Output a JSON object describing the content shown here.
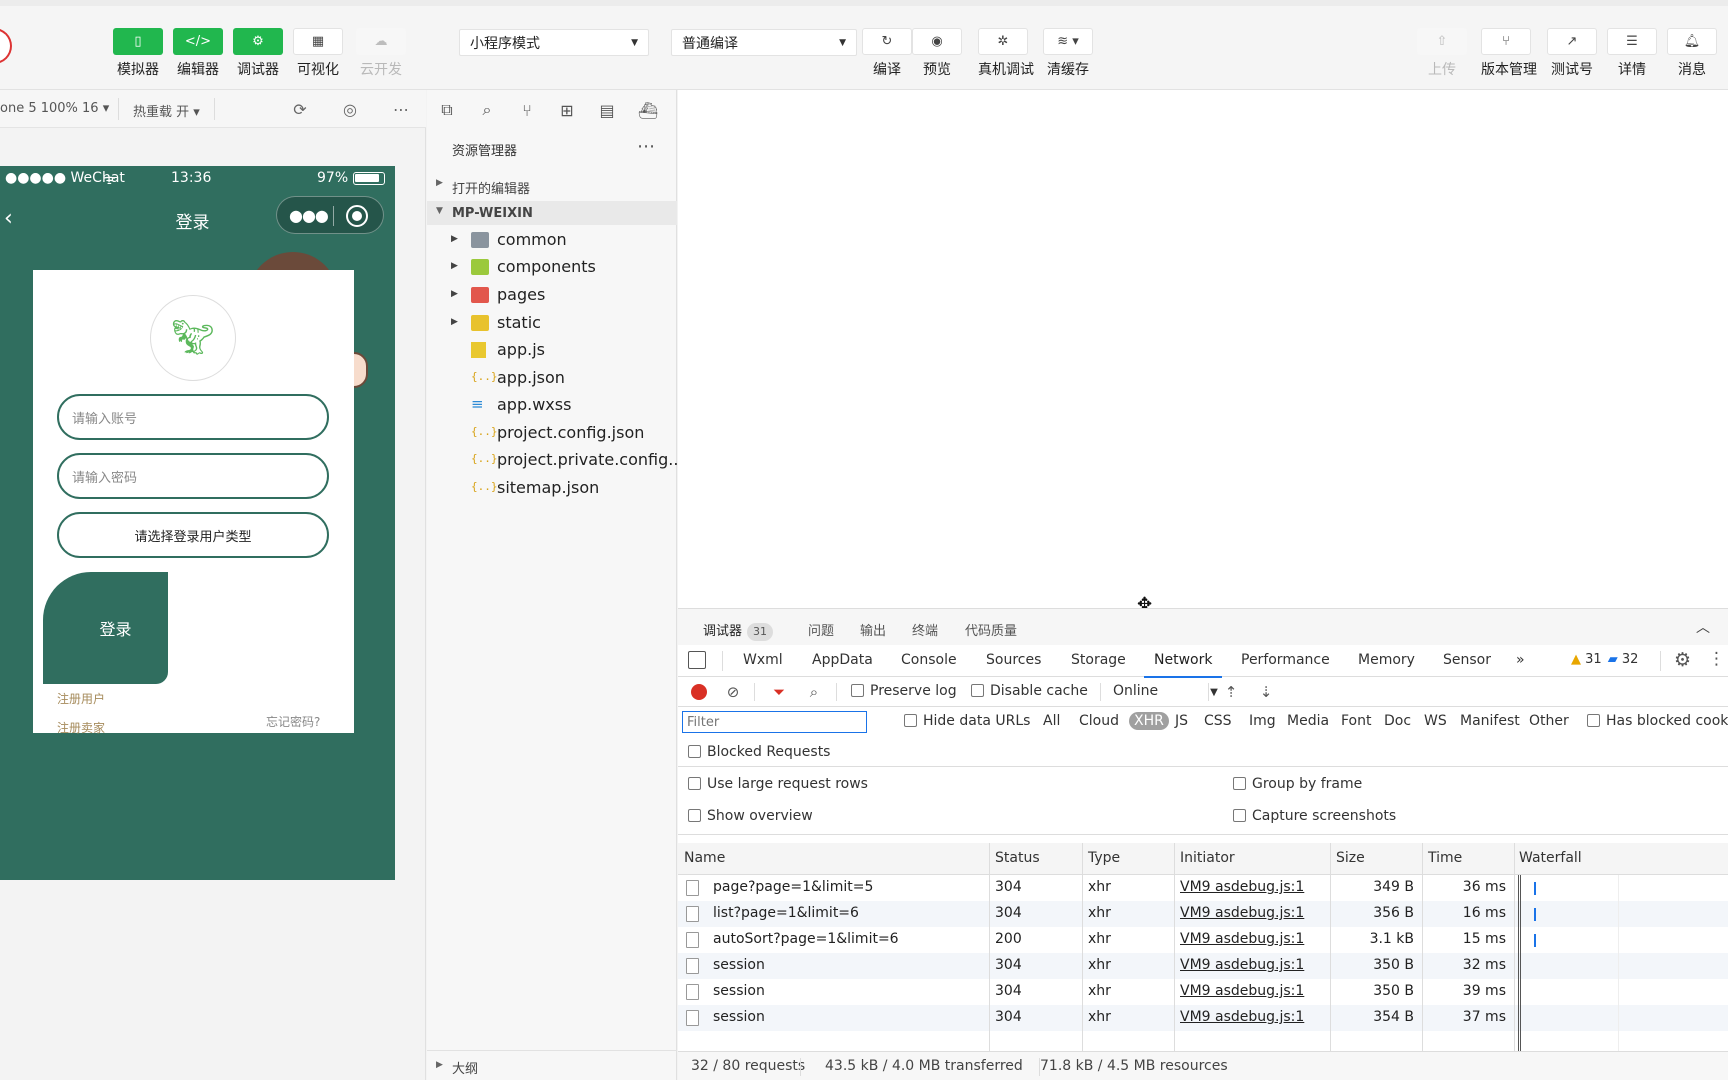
{
  "toolbar": {
    "buttons_left": [
      {
        "label": "模拟器",
        "icon": "phone-icon"
      },
      {
        "label": "编辑器",
        "icon": "code-icon"
      },
      {
        "label": "调试器",
        "icon": "debug-icon"
      },
      {
        "label": "可视化",
        "icon": "layout-icon"
      },
      {
        "label": "云开发",
        "icon": "cloud-icon"
      }
    ],
    "mode_select": "小程序模式",
    "compile_select": "普通编译",
    "buttons_mid": [
      {
        "label": "编译",
        "icon": "refresh-icon"
      },
      {
        "label": "预览",
        "icon": "eye-icon"
      },
      {
        "label": "真机调试",
        "icon": "bug-icon"
      },
      {
        "label": "清缓存",
        "icon": "layers-icon"
      }
    ],
    "buttons_right": [
      {
        "label": "上传",
        "icon": "upload-icon"
      },
      {
        "label": "版本管理",
        "icon": "branch-icon"
      },
      {
        "label": "测试号",
        "icon": "external-link-icon"
      },
      {
        "label": "详情",
        "icon": "menu-icon"
      },
      {
        "label": "消息",
        "icon": "bell-icon"
      }
    ],
    "accent_green": "#21b74e"
  },
  "simulator": {
    "device": "one 5 100% 16",
    "hot_reload": "热重载 开",
    "phone": {
      "carrier": "●●●●● WeChat",
      "time": "13:36",
      "battery": "97%",
      "nav_title": "登录",
      "account_placeholder": "请输入账号",
      "password_placeholder": "请输入密码",
      "user_type_select": "请选择登录用户类型",
      "login_button": "登录",
      "register_user": "注册用户",
      "register_seller": "注册卖家",
      "forgot_password": "忘记密码?",
      "theme_color": "#306e5f"
    }
  },
  "explorer": {
    "title": "资源管理器",
    "open_editors": "打开的编辑器",
    "project": "MP-WEIXIN",
    "items": [
      {
        "name": "common",
        "type": "folder",
        "icon": "folder-icon"
      },
      {
        "name": "components",
        "type": "folder",
        "icon": "folder-components-icon"
      },
      {
        "name": "pages",
        "type": "folder",
        "icon": "folder-pages-icon"
      },
      {
        "name": "static",
        "type": "folder",
        "icon": "folder-static-icon"
      },
      {
        "name": "app.js",
        "type": "js",
        "icon": "js-file-icon"
      },
      {
        "name": "app.json",
        "type": "json",
        "icon": "json-file-icon"
      },
      {
        "name": "app.wxss",
        "type": "wxss",
        "icon": "wxss-file-icon"
      },
      {
        "name": "project.config.json",
        "type": "json",
        "icon": "json-file-icon"
      },
      {
        "name": "project.private.config...",
        "type": "json",
        "icon": "json-file-icon"
      },
      {
        "name": "sitemap.json",
        "type": "json",
        "icon": "json-file-icon"
      }
    ],
    "outline": "大纲"
  },
  "debugger": {
    "top_tabs": [
      {
        "label": "调试器",
        "badge": "31"
      },
      {
        "label": "问题"
      },
      {
        "label": "输出"
      },
      {
        "label": "终端"
      },
      {
        "label": "代码质量"
      }
    ],
    "devtools_tabs": [
      "Wxml",
      "AppData",
      "Console",
      "Sources",
      "Storage",
      "Network",
      "Performance",
      "Memory",
      "Sensor"
    ],
    "more_tabs": "»",
    "active_tab": "Network",
    "warnings": "31",
    "messages": "32",
    "network": {
      "preserve_log": "Preserve log",
      "disable_cache": "Disable cache",
      "throttle": "Online",
      "filter_placeholder": "Filter",
      "hide_data_urls": "Hide data URLs",
      "type_filters": [
        "All",
        "Cloud",
        "XHR",
        "JS",
        "CSS",
        "Img",
        "Media",
        "Font",
        "Doc",
        "WS",
        "Manifest",
        "Other"
      ],
      "active_type": "XHR",
      "has_blocked_cookies": "Has blocked cook",
      "blocked_requests": "Blocked Requests",
      "large_rows": "Use large request rows",
      "group_by_frame": "Group by frame",
      "show_overview": "Show overview",
      "capture_screenshots": "Capture screenshots",
      "columns": [
        "Name",
        "Status",
        "Type",
        "Initiator",
        "Size",
        "Time",
        "Waterfall"
      ],
      "rows": [
        {
          "name": "page?page=1&limit=5",
          "status": "304",
          "type": "xhr",
          "initiator": "VM9 asdebug.js:1",
          "size": "349 B",
          "time": "36 ms"
        },
        {
          "name": "list?page=1&limit=6",
          "status": "304",
          "type": "xhr",
          "initiator": "VM9 asdebug.js:1",
          "size": "356 B",
          "time": "16 ms"
        },
        {
          "name": "autoSort?page=1&limit=6",
          "status": "200",
          "type": "xhr",
          "initiator": "VM9 asdebug.js:1",
          "size": "3.1 kB",
          "time": "15 ms"
        },
        {
          "name": "session",
          "status": "304",
          "type": "xhr",
          "initiator": "VM9 asdebug.js:1",
          "size": "350 B",
          "time": "32 ms"
        },
        {
          "name": "session",
          "status": "304",
          "type": "xhr",
          "initiator": "VM9 asdebug.js:1",
          "size": "350 B",
          "time": "39 ms"
        },
        {
          "name": "session",
          "status": "304",
          "type": "xhr",
          "initiator": "VM9 asdebug.js:1",
          "size": "354 B",
          "time": "37 ms"
        }
      ],
      "summary": {
        "requests": "32 / 80 requests",
        "transferred": "43.5 kB / 4.0 MB transferred",
        "resources": "71.8 kB / 4.5 MB resources"
      }
    }
  }
}
